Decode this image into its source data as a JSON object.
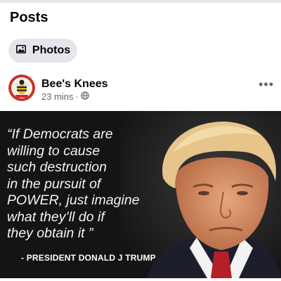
{
  "section": {
    "title": "Posts"
  },
  "filter_chip": {
    "label": "Photos",
    "icon": "photos-icon"
  },
  "post": {
    "author": "Bee's Knees",
    "time": "23 mins",
    "separator": "·",
    "privacy_icon": "globe-icon",
    "more_label": "•••",
    "image": {
      "quote_lines": [
        "“If Democrats are",
        "willing to cause",
        "such destruction",
        "in the pursuit of",
        "POWER, just imagine",
        "what they’ll do if",
        "they obtain it ”"
      ],
      "attribution": "- PRESIDENT DONALD J TRUMP"
    }
  },
  "colors": {
    "chip_bg": "#e4e6eb",
    "meta_text": "#65676b",
    "image_bg": "#141414"
  }
}
